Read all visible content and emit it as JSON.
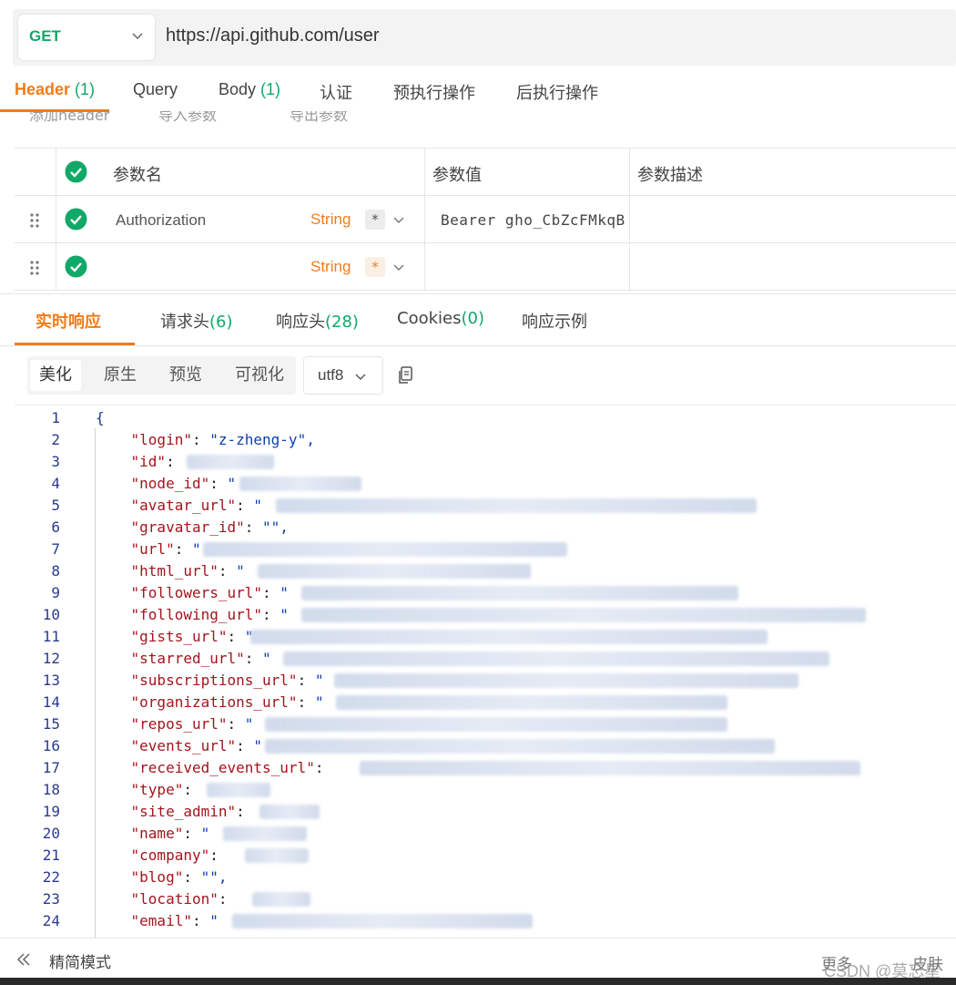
{
  "request": {
    "method": "GET",
    "url": "https://api.github.com/user"
  },
  "request_tabs": [
    {
      "label": "Header",
      "count": "(1)"
    },
    {
      "label": "Query",
      "count": ""
    },
    {
      "label": "Body",
      "count": "(1)"
    },
    {
      "label": "认证",
      "count": ""
    },
    {
      "label": "预执行操作",
      "count": ""
    },
    {
      "label": "后执行操作",
      "count": ""
    }
  ],
  "header_actions": [
    "添加header",
    "导入参数",
    "导出参数"
  ],
  "param_table": {
    "columns": [
      "参数名",
      "参数值",
      "参数描述"
    ],
    "rows": [
      {
        "name": "Authorization",
        "type": "String",
        "required": "*",
        "value": "Bearer gho_CbZcFMkqB",
        "description": ""
      },
      {
        "name": "",
        "type": "String",
        "required": "*",
        "value": "",
        "description": ""
      }
    ]
  },
  "response_tabs": [
    {
      "label": "实时响应",
      "count": ""
    },
    {
      "label": "请求头",
      "count": "(6)"
    },
    {
      "label": "响应头",
      "count": "(28)"
    },
    {
      "label": "Cookies",
      "count": "(0)"
    },
    {
      "label": "响应示例",
      "count": ""
    }
  ],
  "view_modes": [
    "美化",
    "原生",
    "预览",
    "可视化"
  ],
  "encoding": "utf8",
  "code_lines": [
    {
      "n": "1",
      "key": "",
      "value": "{"
    },
    {
      "n": "2",
      "key": "\"login\"",
      "value": "\"z-zheng-y\","
    },
    {
      "n": "3",
      "key": "\"id\"",
      "value": ""
    },
    {
      "n": "4",
      "key": "\"node_id\"",
      "value": "\""
    },
    {
      "n": "5",
      "key": "\"avatar_url\"",
      "value": "\""
    },
    {
      "n": "6",
      "key": "\"gravatar_id\"",
      "value": "\"\","
    },
    {
      "n": "7",
      "key": "\"url\"",
      "value": "\""
    },
    {
      "n": "8",
      "key": "\"html_url\"",
      "value": "\""
    },
    {
      "n": "9",
      "key": "\"followers_url\"",
      "value": "\""
    },
    {
      "n": "10",
      "key": "\"following_url\"",
      "value": "\""
    },
    {
      "n": "11",
      "key": "\"gists_url\"",
      "value": "\""
    },
    {
      "n": "12",
      "key": "\"starred_url\"",
      "value": "\""
    },
    {
      "n": "13",
      "key": "\"subscriptions_url\"",
      "value": "\""
    },
    {
      "n": "14",
      "key": "\"organizations_url\"",
      "value": "\""
    },
    {
      "n": "15",
      "key": "\"repos_url\"",
      "value": "\""
    },
    {
      "n": "16",
      "key": "\"events_url\"",
      "value": "\""
    },
    {
      "n": "17",
      "key": "\"received_events_url\"",
      "value": ""
    },
    {
      "n": "18",
      "key": "\"type\"",
      "value": ""
    },
    {
      "n": "19",
      "key": "\"site_admin\"",
      "value": ""
    },
    {
      "n": "20",
      "key": "\"name\"",
      "value": "\""
    },
    {
      "n": "21",
      "key": "\"company\"",
      "value": ""
    },
    {
      "n": "22",
      "key": "\"blog\"",
      "value": "\"\","
    },
    {
      "n": "23",
      "key": "\"location\"",
      "value": ""
    },
    {
      "n": "24",
      "key": "\"email\"",
      "value": "\""
    }
  ],
  "statusbar": {
    "simple_mode": "精简模式",
    "more": "更多",
    "watermark": "CSDN @莫忘星",
    "skin": "皮肤"
  },
  "colors": {
    "accent": "#f07c1a",
    "success": "#11a868",
    "json_key": "#a3151c",
    "json_string": "#0b3fb0"
  }
}
